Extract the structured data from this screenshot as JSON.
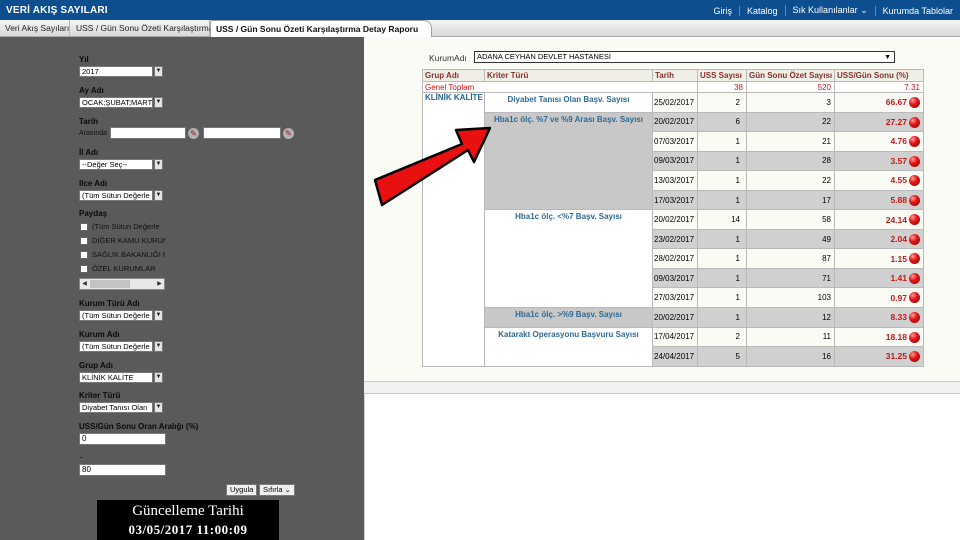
{
  "app": {
    "title": "VERİ AKIŞ SAYILARI"
  },
  "topnav": [
    "Giriş",
    "Katalog",
    "Sık Kullanılanlar ⌄",
    "Kurumda Tablolar"
  ],
  "tabs": [
    "Veri Akış Sayıları",
    "USS / Gün Sonu Özeti Karşılaştırma",
    "USS / Gün Sonu Özeti Karşılaştırma Detay Raporu"
  ],
  "filters": {
    "yil": {
      "label": "Yıl",
      "value": "2017"
    },
    "ay": {
      "label": "Ay Adı",
      "value": "OCAK;ŞUBAT;MART;N"
    },
    "tarih": {
      "label": "Tarih",
      "between": "Arasında"
    },
    "il": {
      "label": "İl Adı",
      "value": "--Değer Seç--"
    },
    "ilce": {
      "label": "Ilce Adı",
      "value": "(Tüm Sütun Değerle"
    },
    "payda": {
      "label": "Paydaş",
      "options": [
        "(Tüm Sütun Değerle",
        "DİĞER KAMU KURUM",
        "SAĞLIK BAKANLIĞI K",
        "ÖZEL KURUMLAR"
      ]
    },
    "kurum_turu": {
      "label": "Kurum Türü Adı",
      "value": "(Tüm Sütun Değerle"
    },
    "kurum": {
      "label": "Kurum Adı",
      "value": "(Tüm Sütun Değerle"
    },
    "grup": {
      "label": "Grup Adı",
      "value": "KLİNİK KALİTE"
    },
    "kriter": {
      "label": "Kriter Türü",
      "value": "Diyabet Tanısı Olan"
    },
    "oran": {
      "label": "USS/Gün Sonu Oran Aralığı (%)",
      "min": "0",
      "sep": "-",
      "max": "80"
    },
    "apply": "Uygula",
    "reset": "Sıfırla ⌄"
  },
  "update": {
    "title": "Güncelleme Tarihi",
    "date": "03/05/2017 11:00:09"
  },
  "report": {
    "kurum_label": "KurumAdı",
    "kurum_value": "ADANA CEYHAN DEVLET HASTANESİ",
    "headers": [
      "Grup Adı",
      "Kriter Türü",
      "Tarih",
      "USS Sayısı",
      "Gün Sonu Özet Sayısı",
      "USS/Gün Sonu (%)"
    ],
    "total": {
      "label": "Genel Toplam",
      "uss": "38",
      "gunsonu": "520",
      "pct": "7.31"
    },
    "group": "KLİNİK KALİTE",
    "criteria": [
      "Diyabet Tanısı Olan Başv. Sayısı",
      "Hba1c ölç. %7 ve %9 Arası Başv. Sayısı",
      "Hba1c ölç. <%7 Başv. Sayısı",
      "Hba1c ölç. >%9 Başv. Sayısı",
      "Katarakt Operasyonu Başvuru Sayısı"
    ],
    "rows": [
      {
        "tarih": "25/02/2017",
        "uss": "2",
        "gs": "3",
        "pct": "66.67"
      },
      {
        "tarih": "20/02/2017",
        "uss": "6",
        "gs": "22",
        "pct": "27.27"
      },
      {
        "tarih": "07/03/2017",
        "uss": "1",
        "gs": "21",
        "pct": "4.76"
      },
      {
        "tarih": "09/03/2017",
        "uss": "1",
        "gs": "28",
        "pct": "3.57"
      },
      {
        "tarih": "13/03/2017",
        "uss": "1",
        "gs": "22",
        "pct": "4.55"
      },
      {
        "tarih": "17/03/2017",
        "uss": "1",
        "gs": "17",
        "pct": "5.88"
      },
      {
        "tarih": "20/02/2017",
        "uss": "14",
        "gs": "58",
        "pct": "24.14"
      },
      {
        "tarih": "23/02/2017",
        "uss": "1",
        "gs": "49",
        "pct": "2.04"
      },
      {
        "tarih": "28/02/2017",
        "uss": "1",
        "gs": "87",
        "pct": "1.15"
      },
      {
        "tarih": "09/03/2017",
        "uss": "1",
        "gs": "71",
        "pct": "1.41"
      },
      {
        "tarih": "27/03/2017",
        "uss": "1",
        "gs": "103",
        "pct": "0.97"
      },
      {
        "tarih": "20/02/2017",
        "uss": "1",
        "gs": "12",
        "pct": "8.33"
      },
      {
        "tarih": "17/04/2017",
        "uss": "2",
        "gs": "11",
        "pct": "18.18"
      },
      {
        "tarih": "24/04/2017",
        "uss": "5",
        "gs": "16",
        "pct": "31.25"
      }
    ]
  },
  "colors": {
    "topbar": "#0d4e8f",
    "panel": "#5a5a5a",
    "accent_red": "#c21a1a",
    "header_text": "#883030",
    "group_text": "#24648f"
  }
}
